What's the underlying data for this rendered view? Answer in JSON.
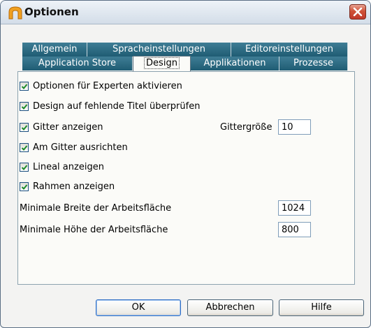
{
  "window": {
    "title": "Optionen",
    "icon": "app-arch-icon",
    "close_icon": "close-icon"
  },
  "tabs": {
    "row1": [
      "Allgemein",
      "Spracheinstellungen",
      "Editoreinstellungen"
    ],
    "row2": [
      "Application Store",
      "Design",
      "Applikationen",
      "Prozesse"
    ],
    "active": "Design"
  },
  "options": [
    {
      "label": "Optionen für Experten aktivieren",
      "checked": true
    },
    {
      "label": "Design auf fehlende Titel überprüfen",
      "checked": true
    },
    {
      "label": "Gitter anzeigen",
      "checked": true
    },
    {
      "label": "Am Gitter ausrichten",
      "checked": true
    },
    {
      "label": "Lineal anzeigen",
      "checked": true
    },
    {
      "label": "Rahmen anzeigen",
      "checked": true
    }
  ],
  "grid": {
    "label": "Gittergröße",
    "value": "10"
  },
  "min_width": {
    "label": "Minimale Breite der Arbeitsfläche",
    "value": "1024"
  },
  "min_height": {
    "label": "Minimale Höhe der Arbeitsfläche",
    "value": "800"
  },
  "buttons": {
    "ok": "OK",
    "cancel": "Abbrechen",
    "help": "Hilfe"
  },
  "colors": {
    "tab": "#2b6a82",
    "close": "#c94a35",
    "accent": "#2e6ec4"
  }
}
